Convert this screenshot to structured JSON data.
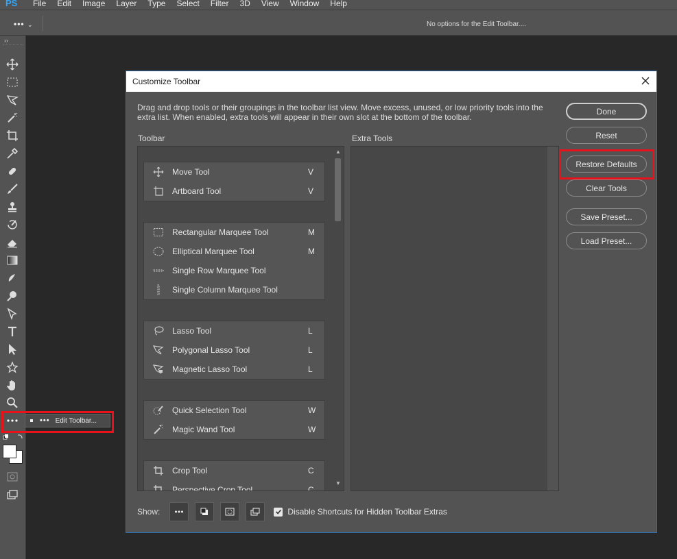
{
  "app": {
    "logo": "PS"
  },
  "menu": [
    "File",
    "Edit",
    "Image",
    "Layer",
    "Type",
    "Select",
    "Filter",
    "3D",
    "View",
    "Window",
    "Help"
  ],
  "options_bar": {
    "tool_icon": "•••",
    "message": "No options for the Edit Toolbar...."
  },
  "left_toolbar": {
    "collapse_glyph": "››",
    "tools": [
      "move-icon",
      "marquee-icon",
      "lasso-icon",
      "magic-wand-icon",
      "crop-icon",
      "eyedropper-icon",
      "healing-icon",
      "brush-icon",
      "stamp-icon",
      "history-brush-icon",
      "eraser-icon",
      "gradient-icon",
      "blur-icon",
      "dodge-icon",
      "pen-icon",
      "type-icon",
      "path-selection-icon",
      "shape-icon",
      "hand-icon",
      "zoom-icon"
    ],
    "edit_toolbar_flyout": {
      "dots": "•••",
      "label": "Edit Toolbar..."
    }
  },
  "dialog": {
    "title": "Customize Toolbar",
    "description": "Drag and drop tools or their groupings in the toolbar list view. Move excess, unused, or low priority tools into the extra list. When enabled, extra tools will appear in their own slot at the bottom of the toolbar.",
    "toolbar_label": "Toolbar",
    "extra_label": "Extra Tools",
    "groups": [
      {
        "tools": [
          {
            "name": "Move Tool",
            "shortcut": "V",
            "icon": "move-icon"
          },
          {
            "name": "Artboard Tool",
            "shortcut": "V",
            "icon": "artboard-icon"
          }
        ]
      },
      {
        "tools": [
          {
            "name": "Rectangular Marquee Tool",
            "shortcut": "M",
            "icon": "rect-marquee-icon"
          },
          {
            "name": "Elliptical Marquee Tool",
            "shortcut": "M",
            "icon": "ellipse-marquee-icon"
          },
          {
            "name": "Single Row Marquee Tool",
            "shortcut": "",
            "icon": "row-marquee-icon"
          },
          {
            "name": "Single Column Marquee Tool",
            "shortcut": "",
            "icon": "column-marquee-icon"
          }
        ]
      },
      {
        "tools": [
          {
            "name": "Lasso Tool",
            "shortcut": "L",
            "icon": "lasso-icon"
          },
          {
            "name": "Polygonal Lasso Tool",
            "shortcut": "L",
            "icon": "polygonal-lasso-icon"
          },
          {
            "name": "Magnetic Lasso Tool",
            "shortcut": "L",
            "icon": "magnetic-lasso-icon"
          }
        ]
      },
      {
        "tools": [
          {
            "name": "Quick Selection Tool",
            "shortcut": "W",
            "icon": "quick-selection-icon"
          },
          {
            "name": "Magic Wand Tool",
            "shortcut": "W",
            "icon": "magic-wand-icon"
          }
        ]
      },
      {
        "tools": [
          {
            "name": "Crop Tool",
            "shortcut": "C",
            "icon": "crop-icon"
          },
          {
            "name": "Perspective Crop Tool",
            "shortcut": "C",
            "icon": "perspective-crop-icon"
          }
        ]
      }
    ],
    "buttons": {
      "done": "Done",
      "reset": "Reset",
      "restore": "Restore Defaults",
      "clear": "Clear Tools",
      "save": "Save Preset...",
      "load": "Load Preset..."
    },
    "show_label": "Show:",
    "show_icons": [
      "ellipsis-icon",
      "swap-colors-icon",
      "quick-mask-icon",
      "screen-mode-icon"
    ],
    "checkbox_label": "Disable Shortcuts for Hidden Toolbar Extras",
    "checkbox_checked": true
  }
}
